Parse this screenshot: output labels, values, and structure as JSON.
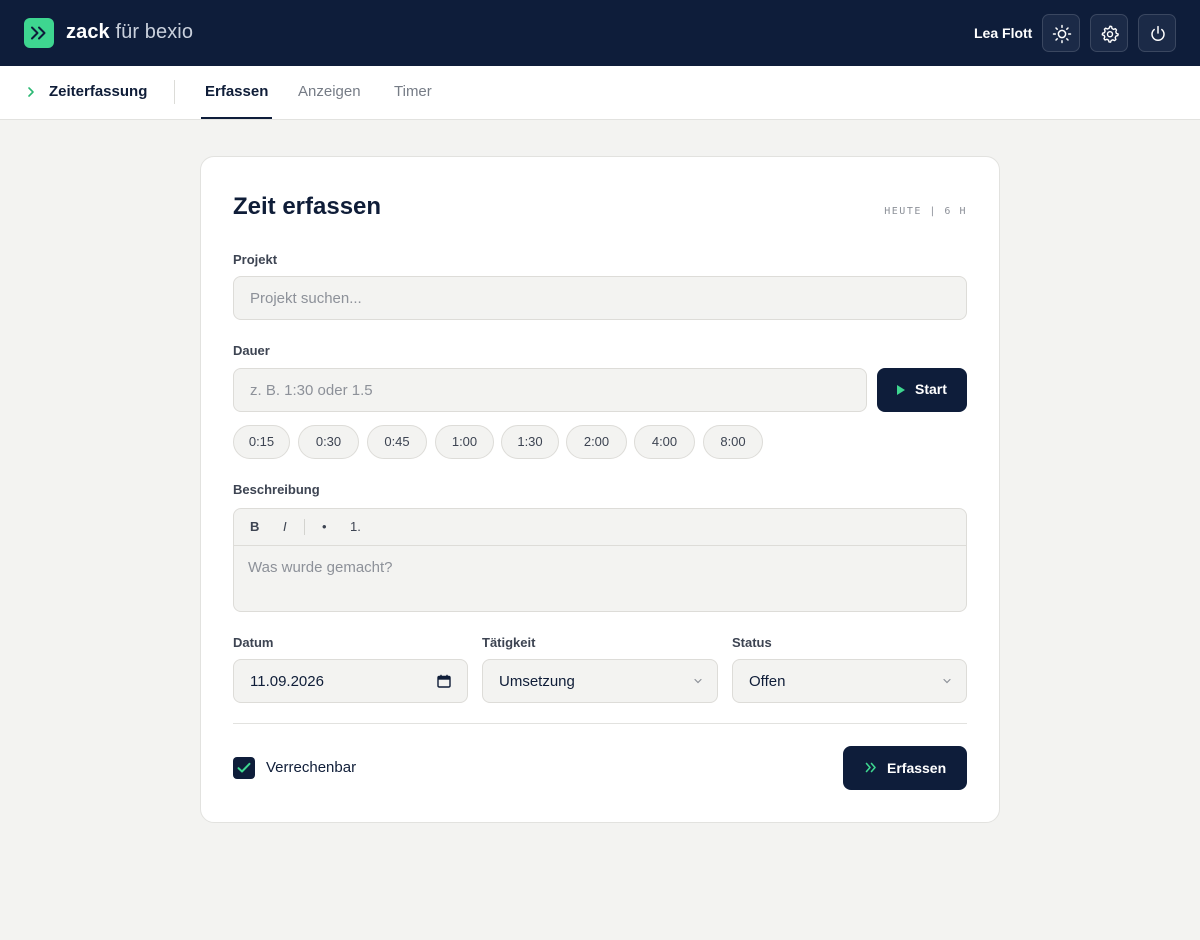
{
  "header": {
    "brand_strong": "zack",
    "brand_light": "für bexio",
    "user_name": "Lea Flott",
    "icons": [
      "theme-sun-icon",
      "settings-gear-icon",
      "power-icon"
    ],
    "colors": {
      "navy": "#0e1d3a",
      "accent": "#3ed690"
    }
  },
  "subnav": {
    "section": "Zeiterfassung",
    "tabs": [
      {
        "label": "Erfassen",
        "active": true
      },
      {
        "label": "Anzeigen",
        "active": false
      },
      {
        "label": "Timer",
        "active": false
      }
    ]
  },
  "form": {
    "title": "Zeit erfassen",
    "today_summary": "HEUTE | 6 H",
    "project": {
      "label": "Projekt",
      "placeholder": "Projekt suchen..."
    },
    "duration": {
      "label": "Dauer",
      "placeholder": "z. B. 1:30 oder 1.5",
      "start_label": "Start",
      "presets": [
        "0:15",
        "0:30",
        "0:45",
        "1:00",
        "1:30",
        "2:00",
        "4:00",
        "8:00"
      ]
    },
    "description": {
      "label": "Beschreibung",
      "toolbar": {
        "bold": "B",
        "italic": "I",
        "bullet": "•",
        "numbered": "1."
      },
      "placeholder": "Was wurde gemacht?"
    },
    "date": {
      "label": "Datum",
      "value": "11.09.2026"
    },
    "activity": {
      "label": "Tätigkeit",
      "value": "Umsetzung"
    },
    "status": {
      "label": "Status",
      "value": "Offen"
    },
    "billable": {
      "label": "Verrechenbar",
      "checked": true
    },
    "submit_label": "Erfassen"
  }
}
